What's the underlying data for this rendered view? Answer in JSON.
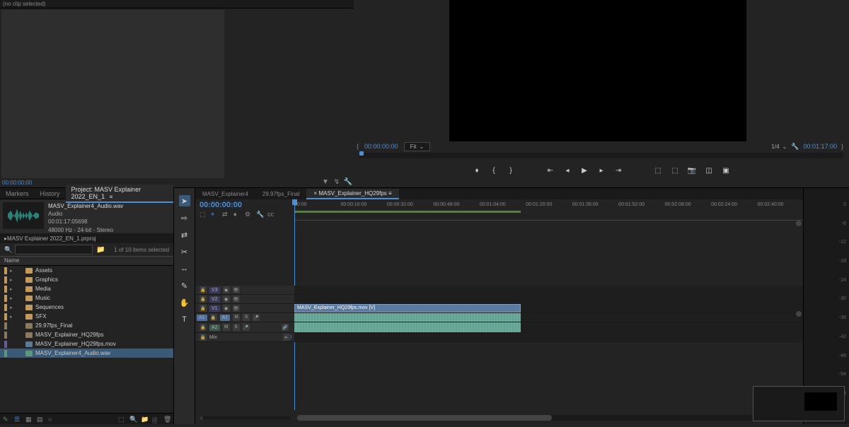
{
  "source": {
    "title": "(no clip selected)",
    "tc": "00:00:00:00"
  },
  "program": {
    "tc_left": "00:00:00:00",
    "fit": "Fit",
    "quality": "1/4",
    "tc_right": "00:01:17:00"
  },
  "project": {
    "tabs": {
      "markers": "Markers",
      "history": "History",
      "project": "Project: MASV Explainer 2022_EN_1"
    },
    "preview": {
      "name": "MASV_Explainer4_Audio.wav",
      "type": "Audio",
      "duration": "00:01:17:05698",
      "format": "48000 Hz - 24-bit - Stereo"
    },
    "project_file": "MASV Explainer 2022_EN_1.prproj",
    "search_placeholder": "",
    "count": "1 of 10 items selected",
    "header_name": "Name",
    "items": [
      {
        "label": "Assets",
        "type": "folder"
      },
      {
        "label": "Graphics",
        "type": "folder"
      },
      {
        "label": "Media",
        "type": "folder"
      },
      {
        "label": "Music",
        "type": "folder"
      },
      {
        "label": "Sequences",
        "type": "folder"
      },
      {
        "label": "SFX",
        "type": "folder"
      },
      {
        "label": "29.97fps_Final",
        "type": "seq"
      },
      {
        "label": "MASV_Explainer_HQ29fps",
        "type": "seq"
      },
      {
        "label": "MASV_Explainer_HQ29fps.mov",
        "type": "vid"
      },
      {
        "label": "MASV_Explainer4_Audio.wav",
        "type": "aud",
        "selected": true
      }
    ]
  },
  "timeline": {
    "tabs": [
      "MASV_Explainer4",
      "29.97fps_Final",
      "MASV_Explainer_HQ29fps"
    ],
    "tc": "00:00:00:00",
    "ticks": [
      "00:00",
      "00:00:16:00",
      "00:00:32:00",
      "00:00:48:00",
      "00:01:04:00",
      "00:01:20:00",
      "00:01:36:00",
      "00:01:52:00",
      "00:02:08:00",
      "00:02:24:00",
      "00:02:40:00"
    ],
    "tracks": {
      "v3": "V3",
      "v2": "V2",
      "v1": "V1",
      "a1": "A1",
      "a2": "A2",
      "mix": "Mix",
      "mix_val": "0.0"
    },
    "head_btns": {
      "lock": "🔒",
      "mute": "M",
      "solo": "S",
      "eye": "👁",
      "rec": "●"
    },
    "clip_label": "MASV_Explainer_HQ29fps.mov [V]"
  },
  "meter_labels": [
    "0",
    "-6",
    "-12",
    "-18",
    "-24",
    "-30",
    "-36",
    "-42",
    "-48",
    "-54",
    "dB"
  ]
}
